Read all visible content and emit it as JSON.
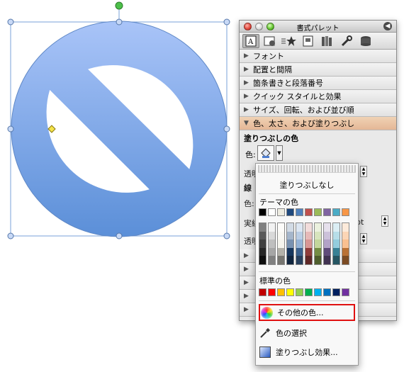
{
  "palette": {
    "title": "書式パレット",
    "toolbar_icons": [
      "text-format-icon",
      "picture-icon",
      "bullets-star-icon",
      "document-icon",
      "books-icon",
      "wrench-icon",
      "database-icon"
    ],
    "sections": [
      {
        "label": "フォント",
        "open": false
      },
      {
        "label": "配置と間隔",
        "open": false
      },
      {
        "label": "箇条書きと段落番号",
        "open": false
      },
      {
        "label": "クイック スタイルと効果",
        "open": false
      },
      {
        "label": "サイズ、回転、および並び順",
        "open": false
      },
      {
        "label": "色、太さ、および塗りつぶし",
        "open": true
      }
    ],
    "fill_heading": "塗りつぶしの色",
    "color_label": "色:",
    "partial_labels": {
      "transparency_1": "透明",
      "line": "線",
      "color_2": "色:",
      "style": "実線",
      "weight": "pt",
      "transparency_2": "透明"
    }
  },
  "color_popup": {
    "no_fill": "塗りつぶしなし",
    "theme_label": "テーマの色",
    "theme_colors": [
      "#000000",
      "#ffffff",
      "#eeece1",
      "#1f497d",
      "#4f81bd",
      "#c0504d",
      "#9bbb59",
      "#8064a2",
      "#4bacc6",
      "#f79646"
    ],
    "standard_label": "標準の色",
    "standard_colors": [
      "#c00000",
      "#ff0000",
      "#ffc000",
      "#ffff00",
      "#92d050",
      "#00b050",
      "#00b0f0",
      "#0070c0",
      "#002060",
      "#7030a0"
    ],
    "menu": {
      "other_colors": "その他の色...",
      "pick_color": "色の選択",
      "fill_effects": "塗りつぶし効果..."
    }
  },
  "colors": {
    "shape_top": "#a6c1f7",
    "shape_bottom": "#5a8fd9",
    "highlight": "#e01010"
  }
}
